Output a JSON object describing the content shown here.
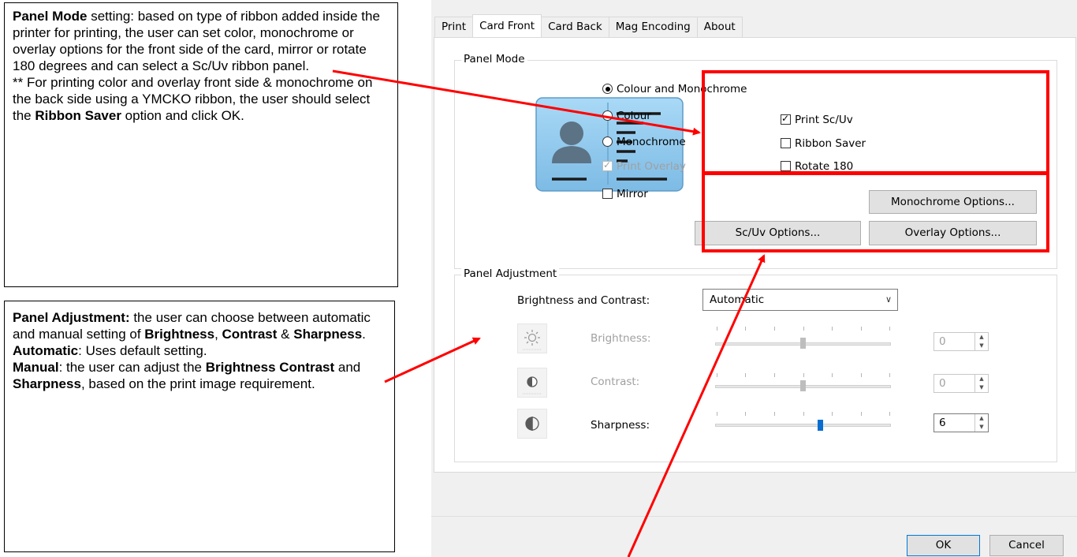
{
  "callouts": {
    "panel_mode": {
      "title": "Panel Mode",
      "text1": " setting: based on type of ribbon added inside the printer for printing, the user can set color, monochrome or overlay options for the front side of the card, mirror or rotate 180 degrees and can select a Sc/Uv ribbon panel.",
      "text2": "** For printing color and overlay front side & monochrome on the back side using a YMCKO ribbon, the user should select the ",
      "bold2": "Ribbon Saver",
      "text3": " option and click OK."
    },
    "panel_adjustment": {
      "title": "Panel Adjustment:",
      "text1": " the user can choose between automatic and manual setting of ",
      "b_brightness": "Brightness",
      "sep1": ", ",
      "b_contrast": "Contrast",
      "sep2": " & ",
      "b_sharpness": "Sharpness",
      "sep3": ".",
      "b_automatic": "Automatic",
      "text_automatic": ": Uses default setting.",
      "b_manual": "Manual",
      "text_manual": ": the user can adjust the ",
      "b_bc": "Brightness Contrast",
      "and": " and ",
      "b_sharp2": "Sharpness",
      "text_end": ", based on the print image requirement."
    }
  },
  "dialog": {
    "tabs": [
      "Print",
      "Card Front",
      "Card Back",
      "Mag Encoding",
      "About"
    ],
    "active_tab": "Card Front",
    "panel_mode": {
      "legend": "Panel Mode",
      "radio_colour_mono": "Colour and Monochrome",
      "radio_colour": "Colour",
      "radio_mono": "Monochrome",
      "check_print_overlay": "Print Overlay",
      "check_print_scuv": "Print Sc/Uv",
      "check_ribbon_saver": "Ribbon Saver",
      "check_rotate": "Rotate 180",
      "check_mirror": "Mirror",
      "btn_mono_options": "Monochrome Options...",
      "btn_scuv_options": "Sc/Uv Options...",
      "btn_overlay_options": "Overlay Options..."
    },
    "panel_adjustment": {
      "legend": "Panel Adjustment",
      "bc_label": "Brightness and Contrast:",
      "bc_value": "Automatic",
      "brightness_label": "Brightness:",
      "brightness_value": "0",
      "contrast_label": "Contrast:",
      "contrast_value": "0",
      "sharpness_label": "Sharpness:",
      "sharpness_value": "6"
    },
    "ok_label": "OK",
    "cancel_label": "Cancel"
  },
  "colors": {
    "annotation_red": "#ff0000",
    "card_blue": "#8ec9ef",
    "slider_active": "#0a6ed1"
  }
}
